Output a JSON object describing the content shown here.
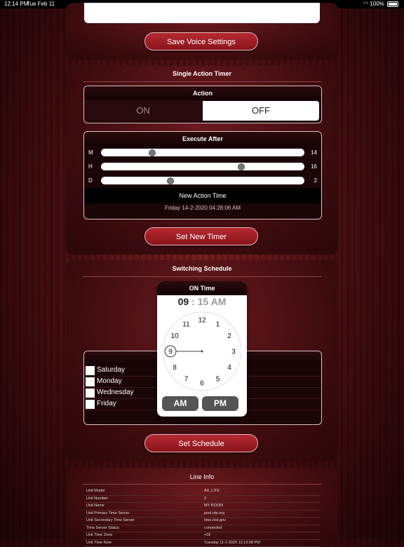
{
  "status_bar": {
    "time": "12:14 PM",
    "date": "Tue Feb 11",
    "battery": "100%"
  },
  "voice": {
    "save_label": "Save Voice Settings"
  },
  "timer": {
    "title": "Single Action Timer",
    "action_header": "Action",
    "on_label": "ON",
    "off_label": "OFF",
    "execute_header": "Execute After",
    "sliders": [
      {
        "label": "M",
        "value": "14",
        "fraction": 0.25
      },
      {
        "label": "H",
        "value": "16",
        "fraction": 0.69
      },
      {
        "label": "D",
        "value": "2",
        "fraction": 0.34
      }
    ],
    "new_action_label": "New Action Time",
    "new_action_time": "Friday 14-2-2020 04:28:06 AM",
    "set_label": "Set New Timer"
  },
  "schedule": {
    "title": "Switching Schedule",
    "days": [
      "Saturday",
      "Monday",
      "Wednesday",
      "Friday"
    ],
    "set_label": "Set Schedule",
    "picker": {
      "title": "ON Time",
      "hour": "09",
      "separator": ":",
      "minute": "15",
      "period": "AM",
      "am_label": "AM",
      "pm_label": "PM",
      "clock_numbers": [
        "12",
        "1",
        "2",
        "3",
        "4",
        "5",
        "6",
        "7",
        "8",
        "9",
        "10",
        "11"
      ],
      "selected_hour": 9
    }
  },
  "line_info": {
    "title": "Line Info",
    "rows": [
      {
        "key": "Unit Model",
        "value": "AX_LITE"
      },
      {
        "key": "Unit Number",
        "value": "3"
      },
      {
        "key": "Unit Name",
        "value": "MY ROOM"
      },
      {
        "key": "Unit Primary Time Server",
        "value": "pool.ntp.org"
      },
      {
        "key": "Unit Secondary Time Server",
        "value": "time.nist.gov"
      },
      {
        "key": "Time Server Status",
        "value": "connected"
      },
      {
        "key": "Unit Time Zone",
        "value": "+02"
      },
      {
        "key": "Unit Time Now",
        "value": "Tuesday 11-2-2020 12:13:08 PM"
      }
    ]
  }
}
